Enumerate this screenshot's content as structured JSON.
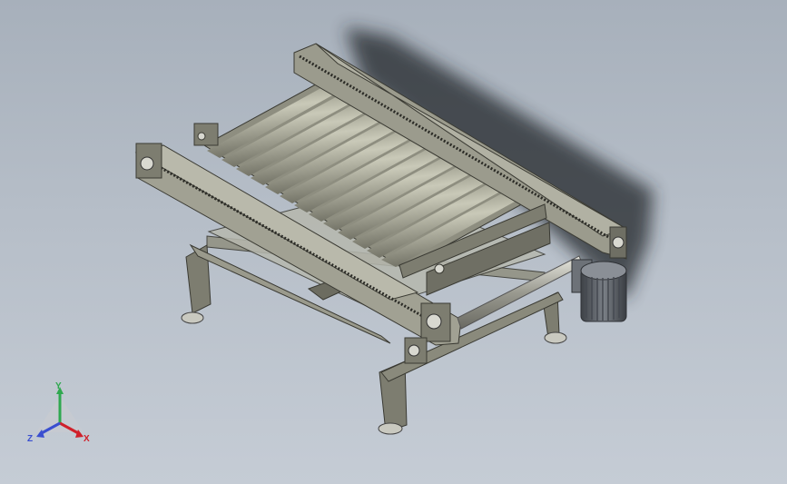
{
  "viewport": {
    "background_top": "#a7b0bb",
    "background_bottom": "#c5ccd5"
  },
  "model": {
    "icon": "roller-conveyor-assembly",
    "body_color": "#8e8e80",
    "roller_color": "#a8a896",
    "motor_color": "#5a5e63",
    "shadow_color": "#22262b"
  },
  "triad": {
    "icon": "coordinate-triad-icon",
    "x_label": "X",
    "y_label": "Y",
    "z_label": "Z",
    "x_color": "#d0202a",
    "y_color": "#2fa84f",
    "z_color": "#3a4fd0"
  }
}
